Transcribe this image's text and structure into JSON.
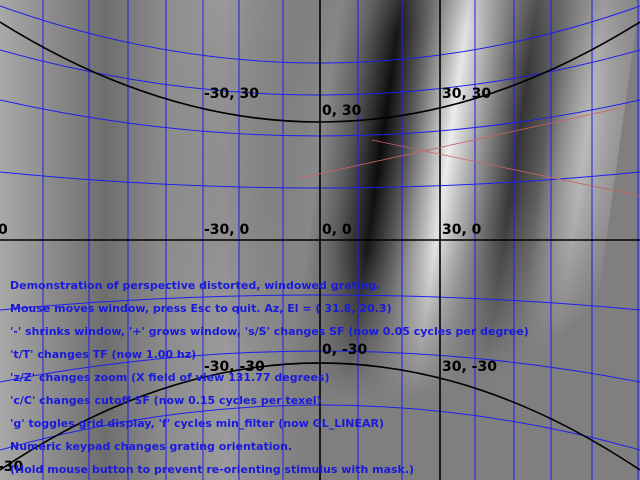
{
  "colors": {
    "background": "#7f7f7f",
    "grid_line": "#1e1ef0",
    "axis_line": "#000000",
    "red_marker": "#c86464",
    "hud_text": "#1a1adc"
  },
  "grid": {
    "labels": {
      "l_m30_30": "-30, 30",
      "l_0_30": "0, 30",
      "l_30_30": "30, 30",
      "l_left_0": "0",
      "l_m30_0": "-30, 0",
      "l_0_0": "0, 0",
      "l_30_0": "30, 0",
      "l_m30_m30": "-30, -30",
      "l_0_m30": "0, -30",
      "l_30_m30": "30, -30",
      "l_left_m30": "-30"
    }
  },
  "hud": {
    "lines": [
      "Demonstration of perspective distorted, windowed grating.",
      "Mouse moves window, press Esc to quit. Az, El = ( 31.8,  20.3)",
      "'-' shrinks window, '+' grows window, 's/S' changes SF (now 0.05 cycles per degree)",
      "'t/T' changes TF (now 1.00 hz)",
      "'z/Z' changes zoom (X field of view 131.77 degrees)",
      "'c/C' changes cutoff SF (now 0.15 cycles per texel)",
      "'g' toggles grid display, 'f' cycles min_filter (now GL_LINEAR)",
      "Numeric keypad changes grating orientation.",
      "(Hold mouse button to prevent re-orienting stimulus with mask.)"
    ]
  }
}
